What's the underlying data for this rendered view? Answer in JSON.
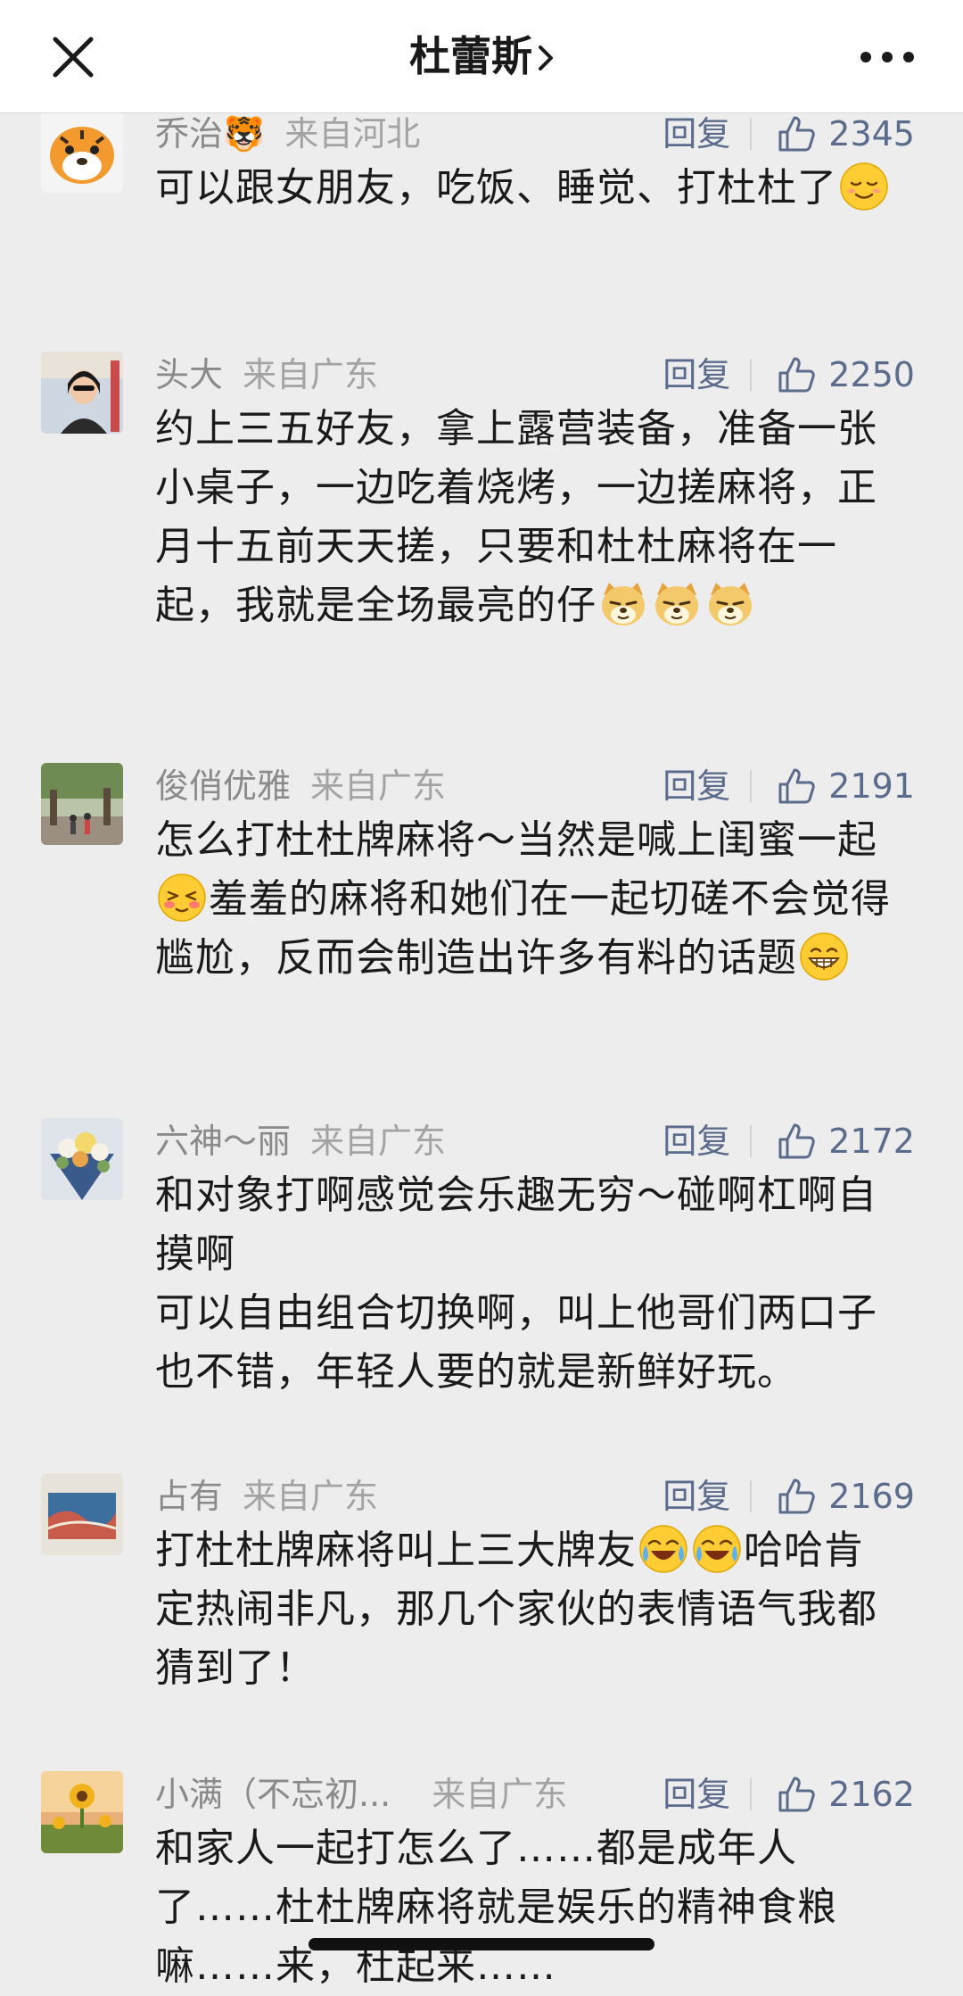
{
  "header": {
    "title": "杜蕾斯",
    "close_icon": "close-icon",
    "more_icon": "more-icon"
  },
  "reply_label": "回复",
  "comments": [
    {
      "name": "乔治🐯",
      "location": "来自河北",
      "likes": "2345",
      "lines": [
        "可以跟女朋友，吃饭、睡觉、打杜杜了"
      ]
    },
    {
      "name": "头大",
      "location": "来自广东",
      "likes": "2250",
      "lines": [
        "约上三五好友，拿上露营装备，准备一张小桌子，一边吃着烧烤，一边搓麻将，正月十五前天天搓，只要和杜杜麻将在一起，我就是全场最亮的仔"
      ]
    },
    {
      "name": "俊俏优雅",
      "location": "来自广东",
      "likes": "2191",
      "lines": [
        "怎么打杜杜牌麻将～当然是喊上闺蜜一起",
        "羞羞的麻将和她们在一起切磋不会觉得尴尬，反而会制造出许多有料的话题"
      ]
    },
    {
      "name": "六神～丽",
      "location": "来自广东",
      "likes": "2172",
      "lines": [
        "和对象打啊感觉会乐趣无穷～碰啊杠啊自摸啊",
        "可以自由组合切换啊，叫上他哥们两口子也不错，年轻人要的就是新鲜好玩。"
      ]
    },
    {
      "name": "占有",
      "location": "来自广东",
      "likes": "2169",
      "lines": [
        "打杜杜牌麻将叫上三大牌友",
        "哈哈肯定热闹非凡，那几个家伙的表情语气我都猜到了！"
      ]
    },
    {
      "name": "小满（不忘初...",
      "location": "来自广东",
      "likes": "2162",
      "lines": [
        "和家人一起打怎么了……都是成年人了……杜杜牌麻将就是娱乐的精神食粮嘛……来，杜起来……"
      ]
    }
  ],
  "colors": {
    "background": "#ededed",
    "meta": "#8a8a8a",
    "action": "#5b6b8c",
    "text": "#1a1a1a"
  }
}
